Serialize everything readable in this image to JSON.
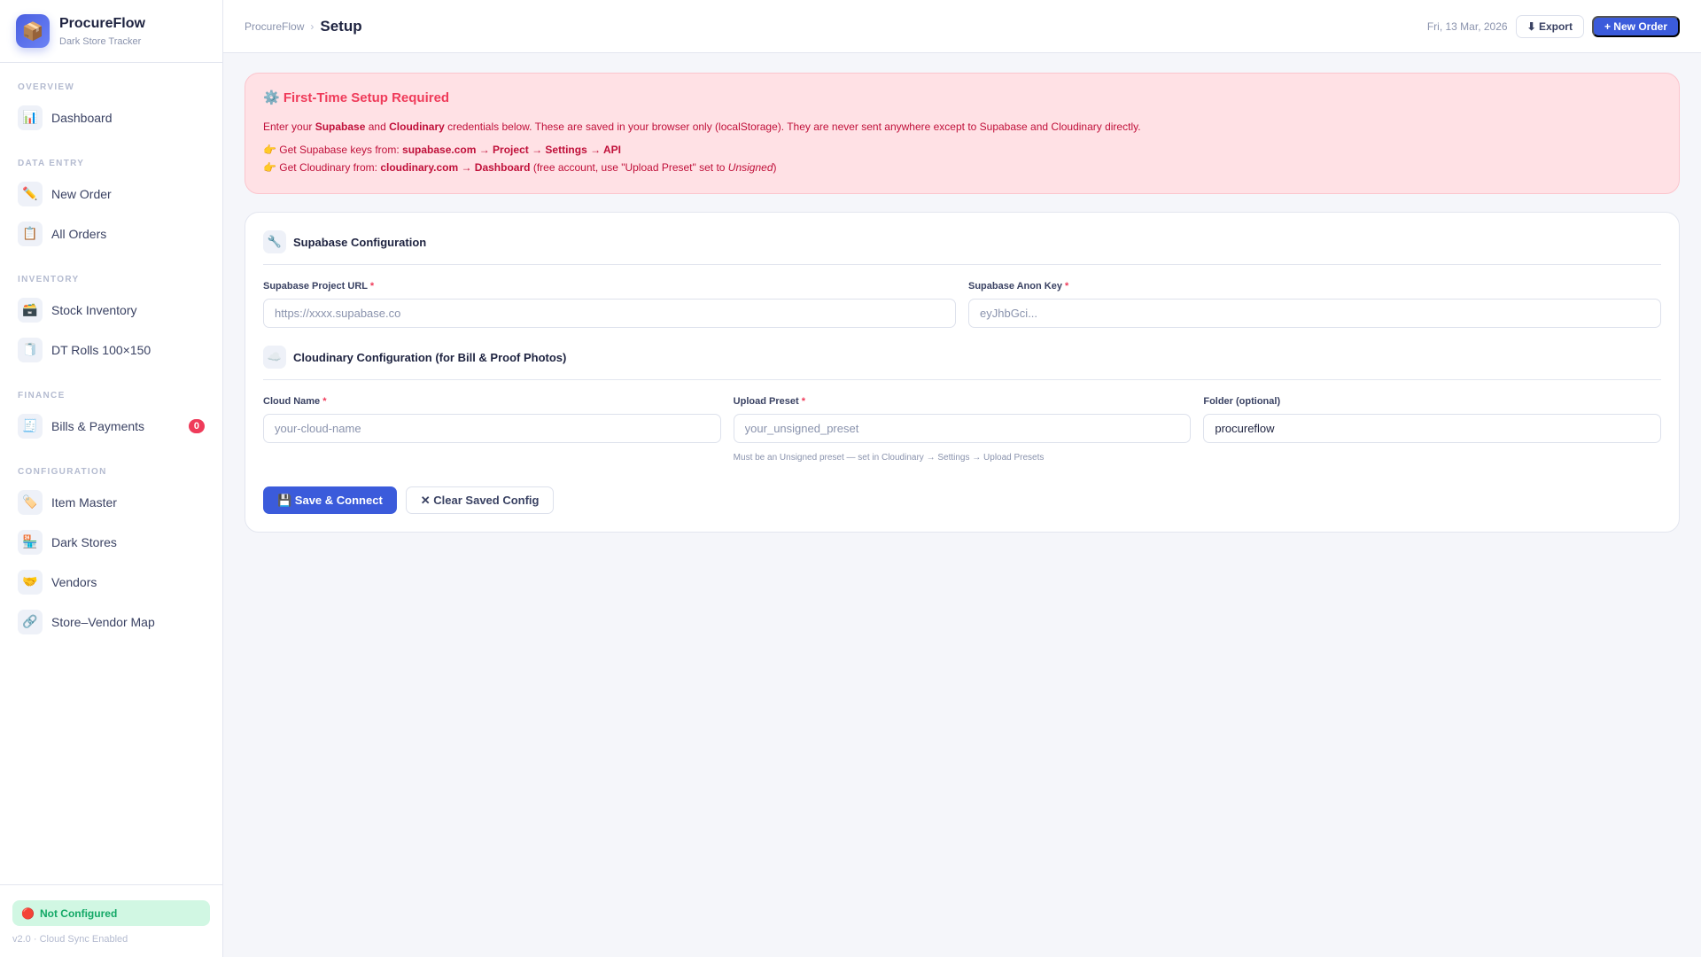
{
  "brand": {
    "name": "ProcureFlow",
    "subtitle": "Dark Store Tracker",
    "logo_icon": "📦"
  },
  "sidebar": {
    "sections": [
      {
        "label": "OVERVIEW",
        "items": [
          {
            "label": "Dashboard",
            "icon": "📊"
          }
        ]
      },
      {
        "label": "DATA ENTRY",
        "items": [
          {
            "label": "New Order",
            "icon": "✏️"
          },
          {
            "label": "All Orders",
            "icon": "📋"
          }
        ]
      },
      {
        "label": "INVENTORY",
        "items": [
          {
            "label": "Stock Inventory",
            "icon": "🗃️"
          },
          {
            "label": "DT Rolls 100×150",
            "icon": "🧻"
          }
        ]
      },
      {
        "label": "FINANCE",
        "items": [
          {
            "label": "Bills & Payments",
            "icon": "🧾",
            "badge": "0"
          }
        ]
      },
      {
        "label": "CONFIGURATION",
        "items": [
          {
            "label": "Item Master",
            "icon": "🏷️"
          },
          {
            "label": "Dark Stores",
            "icon": "🏪"
          },
          {
            "label": "Vendors",
            "icon": "🤝"
          },
          {
            "label": "Store–Vendor Map",
            "icon": "🔗"
          }
        ]
      }
    ],
    "status": {
      "icon": "🔴",
      "label": "Not Configured"
    },
    "version": "v2.0 · Cloud Sync Enabled"
  },
  "header": {
    "breadcrumb": "ProcureFlow",
    "separator": "›",
    "title": "Setup",
    "date": "Fri, 13 Mar, 2026",
    "export_label": "⬇ Export",
    "new_order_label": "+ New Order"
  },
  "alert": {
    "title": "⚙️ First-Time Setup Required",
    "intro_1": "Enter your ",
    "intro_b1": "Supabase",
    "intro_2": " and ",
    "intro_b2": "Cloudinary",
    "intro_3": " credentials below. These are saved in your browser only (localStorage). They are never sent anywhere except to Supabase and Cloudinary directly.",
    "line1_pre": "👉 Get Supabase keys from: ",
    "line1_bold": "supabase.com → Project → Settings → API",
    "line2_pre": "👉 Get Cloudinary from: ",
    "line2_bold": "cloudinary.com → Dashboard",
    "line2_mid": " (free account, use \"Upload Preset\" set to ",
    "line2_em": "Unsigned",
    "line2_end": ")"
  },
  "supabase": {
    "icon": "🔧",
    "title": "Supabase Configuration",
    "url": {
      "label": "Supabase Project URL",
      "placeholder": "https://xxxx.supabase.co",
      "value": ""
    },
    "key": {
      "label": "Supabase Anon Key",
      "placeholder": "eyJhbGci...",
      "value": ""
    }
  },
  "cloudinary": {
    "icon": "☁️",
    "title": "Cloudinary Configuration (for Bill & Proof Photos)",
    "cloud": {
      "label": "Cloud Name",
      "placeholder": "your-cloud-name",
      "value": ""
    },
    "preset": {
      "label": "Upload Preset",
      "placeholder": "your_unsigned_preset",
      "value": "",
      "hint": "Must be an Unsigned preset — set in Cloudinary → Settings → Upload Presets"
    },
    "folder": {
      "label": "Folder (optional)",
      "value": "procureflow"
    }
  },
  "required_mark": "*",
  "actions": {
    "save": "💾 Save & Connect",
    "clear": "✕ Clear Saved Config"
  }
}
